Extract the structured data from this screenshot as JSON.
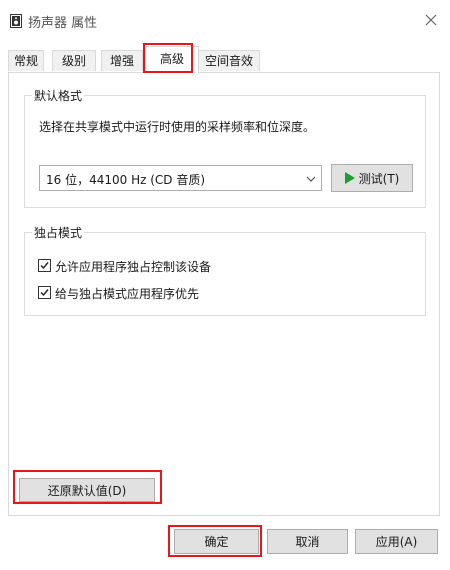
{
  "window": {
    "title": "扬声器 属性",
    "icon": "speaker-icon",
    "close_icon": "close-icon"
  },
  "tabs": [
    {
      "label": "常规",
      "active": false
    },
    {
      "label": "级别",
      "active": false
    },
    {
      "label": "增强",
      "active": false
    },
    {
      "label": "高级",
      "active": true
    },
    {
      "label": "空间音效",
      "active": false
    }
  ],
  "default_format": {
    "title": "默认格式",
    "description": "选择在共享模式中运行时使用的采样频率和位深度。",
    "selected_format": "16 位，44100 Hz (CD 音质)",
    "test_button": "测试(T)",
    "test_icon": "play-icon"
  },
  "exclusive_mode": {
    "title": "独占模式",
    "options": [
      {
        "label": "允许应用程序独占控制该设备",
        "checked": true
      },
      {
        "label": "给与独占模式应用程序优先",
        "checked": true
      }
    ]
  },
  "restore_defaults_button": "还原默认值(D)",
  "footer": {
    "ok": "确定",
    "cancel": "取消",
    "apply": "应用(A)"
  },
  "colors": {
    "highlight": "#e8151b",
    "play_icon": "#1e9e2e",
    "button_face": "#e1e1e1"
  }
}
